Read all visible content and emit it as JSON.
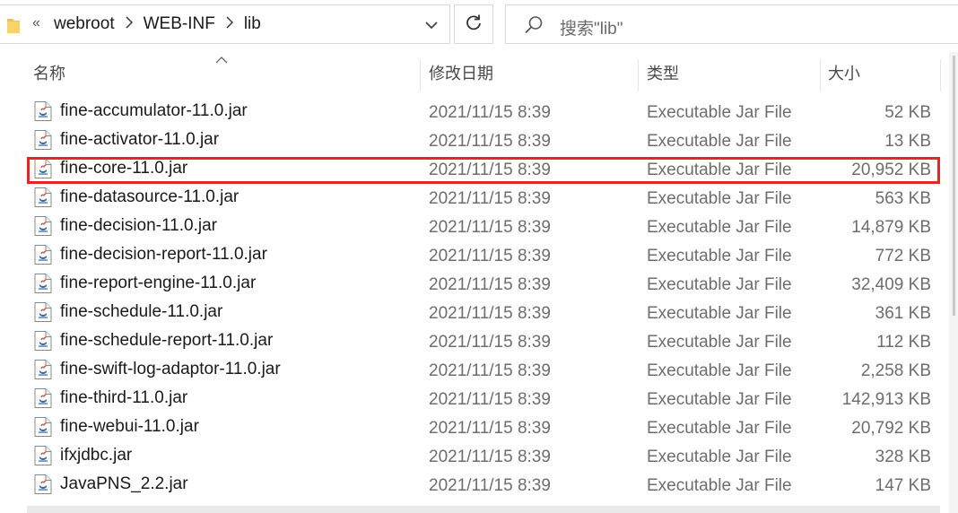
{
  "address_bar": {
    "overflow_chevron": "«",
    "crumbs": [
      "webroot",
      "WEB-INF",
      "lib"
    ]
  },
  "search": {
    "placeholder": "搜索\"lib\""
  },
  "columns": {
    "name": "名称",
    "date": "修改日期",
    "type": "类型",
    "size": "大小"
  },
  "files": [
    {
      "name": "fine-accumulator-11.0.jar",
      "date": "2021/11/15 8:39",
      "type": "Executable Jar File",
      "size": "52 KB"
    },
    {
      "name": "fine-activator-11.0.jar",
      "date": "2021/11/15 8:39",
      "type": "Executable Jar File",
      "size": "13 KB"
    },
    {
      "name": "fine-core-11.0.jar",
      "date": "2021/11/15 8:39",
      "type": "Executable Jar File",
      "size": "20,952 KB"
    },
    {
      "name": "fine-datasource-11.0.jar",
      "date": "2021/11/15 8:39",
      "type": "Executable Jar File",
      "size": "563 KB"
    },
    {
      "name": "fine-decision-11.0.jar",
      "date": "2021/11/15 8:39",
      "type": "Executable Jar File",
      "size": "14,879 KB"
    },
    {
      "name": "fine-decision-report-11.0.jar",
      "date": "2021/11/15 8:39",
      "type": "Executable Jar File",
      "size": "772 KB"
    },
    {
      "name": "fine-report-engine-11.0.jar",
      "date": "2021/11/15 8:39",
      "type": "Executable Jar File",
      "size": "32,409 KB"
    },
    {
      "name": "fine-schedule-11.0.jar",
      "date": "2021/11/15 8:39",
      "type": "Executable Jar File",
      "size": "361 KB"
    },
    {
      "name": "fine-schedule-report-11.0.jar",
      "date": "2021/11/15 8:39",
      "type": "Executable Jar File",
      "size": "112 KB"
    },
    {
      "name": "fine-swift-log-adaptor-11.0.jar",
      "date": "2021/11/15 8:39",
      "type": "Executable Jar File",
      "size": "2,258 KB"
    },
    {
      "name": "fine-third-11.0.jar",
      "date": "2021/11/15 8:39",
      "type": "Executable Jar File",
      "size": "142,913 KB"
    },
    {
      "name": "fine-webui-11.0.jar",
      "date": "2021/11/15 8:39",
      "type": "Executable Jar File",
      "size": "20,792 KB"
    },
    {
      "name": "ifxjdbc.jar",
      "date": "2021/11/15 8:39",
      "type": "Executable Jar File",
      "size": "328 KB"
    },
    {
      "name": "JavaPNS_2.2.jar",
      "date": "2021/11/15 8:39",
      "type": "Executable Jar File",
      "size": "147 KB"
    }
  ],
  "highlighted_file": "fine-core-11.0.jar",
  "colors": {
    "highlight": "#e32626",
    "folder": "#f0c24a"
  }
}
